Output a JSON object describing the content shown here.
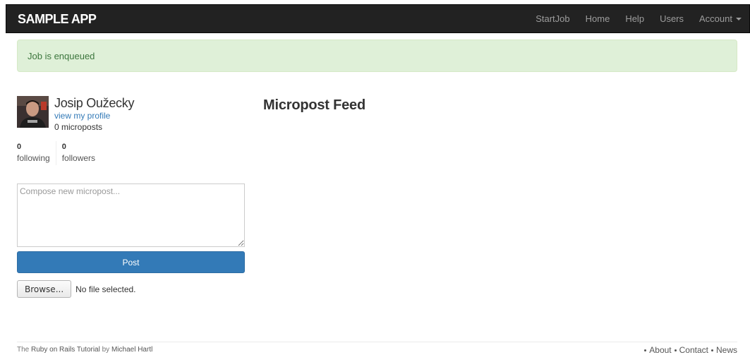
{
  "navbar": {
    "brand": "SAMPLE APP",
    "links": [
      "StartJob",
      "Home",
      "Help",
      "Users",
      "Account"
    ]
  },
  "alert": {
    "message": "Job is enqueued"
  },
  "user": {
    "name": "Josip Oužecky",
    "profile_link": "view my profile",
    "microposts": "0 microposts"
  },
  "stats": {
    "following_count": "0",
    "following_label": "following",
    "followers_count": "0",
    "followers_label": "followers"
  },
  "compose": {
    "placeholder": "Compose new micropost...",
    "value": ""
  },
  "post_button": "Post",
  "file_input": {
    "browse_label": "Browse...",
    "status": "No file selected."
  },
  "feed": {
    "title": "Micropost Feed"
  },
  "footer": {
    "prefix": "The",
    "tutorial_link": "Ruby on Rails Tutorial",
    "by": "by",
    "author_link": "Michael Hartl",
    "links": [
      "About",
      "Contact",
      "News"
    ]
  },
  "colors": {
    "navbar_bg": "#222222",
    "alert_bg": "#dff0d8",
    "alert_text": "#3c763d",
    "primary": "#337ab7",
    "link": "#337ab7"
  },
  "icons": [
    "avatar-image",
    "caret-down-icon",
    "resize-grip-icon"
  ]
}
